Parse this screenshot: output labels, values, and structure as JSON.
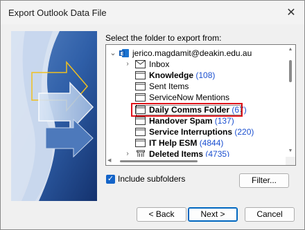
{
  "window": {
    "title": "Export Outlook Data File",
    "close_glyph": "✕"
  },
  "prompt": "Select the folder to export from:",
  "tree": {
    "account": {
      "label": "jerico.magdamit@deakin.edu.au",
      "expander": "⌄"
    },
    "items": [
      {
        "label": "Inbox",
        "count": "",
        "bold": false,
        "expander": "›",
        "icon": "envelope-icon"
      },
      {
        "label": "Knowledge",
        "count": "(108)",
        "bold": true,
        "expander": "",
        "icon": "folder-icon"
      },
      {
        "label": "Sent Items",
        "count": "",
        "bold": false,
        "expander": "",
        "icon": "folder-icon"
      },
      {
        "label": "ServiceNow Mentions",
        "count": "",
        "bold": false,
        "expander": "",
        "icon": "folder-icon"
      },
      {
        "label": "Daily Comms Folder",
        "count": "(67)",
        "bold": true,
        "expander": "",
        "icon": "folder-icon",
        "selected": true
      },
      {
        "label": "Handover Spam",
        "count": "(137)",
        "bold": true,
        "expander": "",
        "icon": "folder-icon"
      },
      {
        "label": "Service Interruptions",
        "count": "(220)",
        "bold": true,
        "expander": "",
        "icon": "folder-icon"
      },
      {
        "label": "IT Help ESM",
        "count": "(4844)",
        "bold": true,
        "expander": "",
        "icon": "folder-icon"
      },
      {
        "label": "Deleted Items",
        "count": "(4735)",
        "bold": true,
        "expander": "›",
        "icon": "trash-icon"
      }
    ]
  },
  "include_subfolders": {
    "label": "Include subfolders",
    "checked": true
  },
  "buttons": {
    "filter": "Filter...",
    "back": "< Back",
    "next": "Next >",
    "cancel": "Cancel"
  },
  "colors": {
    "accent": "#1464c8",
    "highlight": "#e0141b",
    "count": "#1a4fd0"
  }
}
